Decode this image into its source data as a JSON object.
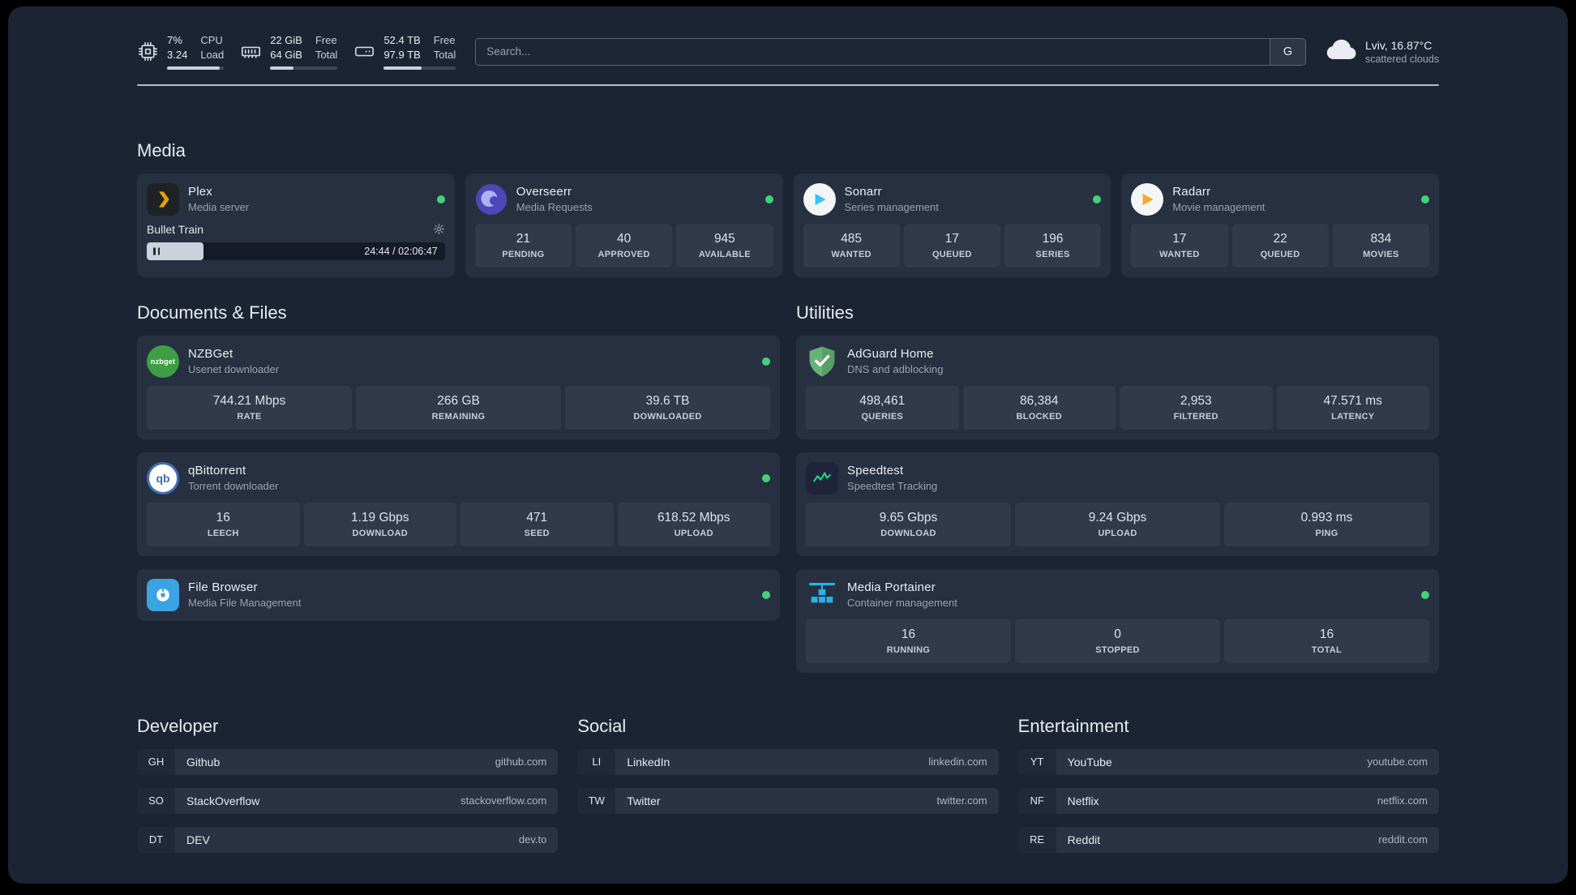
{
  "colors": {
    "background": "#1c2434",
    "card": "#273040",
    "tile": "#303a4b",
    "status_online": "#43d17a",
    "bar_fill": "#ccd3de",
    "plex_accent": "#e5a00d",
    "sonarr_accent": "#35c5f4",
    "radarr_accent": "#f7a823",
    "adguard_accent": "#67b279",
    "speedtest_accent": "#17d97a",
    "portainer_accent": "#29b1e8"
  },
  "icons": {
    "nzbget_label": "nzbget",
    "qbittorrent_label": "qb"
  },
  "topbar": {
    "cpu": {
      "value": "7%",
      "load": "3.24",
      "label_top": "CPU",
      "label_bottom": "Load",
      "bar_pct": 92
    },
    "memory": {
      "free": "22 GiB",
      "total": "64 GiB",
      "label_top": "Free",
      "label_bottom": "Total",
      "bar_pct": 34
    },
    "disk": {
      "free": "52.4 TB",
      "total": "97.9 TB",
      "label_top": "Free",
      "label_bottom": "Total",
      "bar_pct": 53
    },
    "search": {
      "placeholder": "Search...",
      "provider_button": "G"
    },
    "weather": {
      "location": "Lviv, 16.87°C",
      "condition": "scattered clouds"
    }
  },
  "sections": {
    "media": {
      "title": "Media",
      "cards": [
        {
          "name": "Plex",
          "description": "Media server",
          "status": "online",
          "player": {
            "title": "Bullet Train",
            "time": "24:44 / 02:06:47",
            "progress_pct": 19
          }
        },
        {
          "name": "Overseerr",
          "description": "Media Requests",
          "status": "online",
          "stats": [
            {
              "value": "21",
              "label": "PENDING"
            },
            {
              "value": "40",
              "label": "APPROVED"
            },
            {
              "value": "945",
              "label": "AVAILABLE"
            }
          ]
        },
        {
          "name": "Sonarr",
          "description": "Series management",
          "status": "online",
          "stats": [
            {
              "value": "485",
              "label": "WANTED"
            },
            {
              "value": "17",
              "label": "QUEUED"
            },
            {
              "value": "196",
              "label": "SERIES"
            }
          ]
        },
        {
          "name": "Radarr",
          "description": "Movie management",
          "status": "online",
          "stats": [
            {
              "value": "17",
              "label": "WANTED"
            },
            {
              "value": "22",
              "label": "QUEUED"
            },
            {
              "value": "834",
              "label": "MOVIES"
            }
          ]
        }
      ]
    },
    "documents": {
      "title": "Documents & Files",
      "cards": [
        {
          "name": "NZBGet",
          "description": "Usenet downloader",
          "status": "online",
          "stats": [
            {
              "value": "744.21 Mbps",
              "label": "RATE"
            },
            {
              "value": "266 GB",
              "label": "REMAINING"
            },
            {
              "value": "39.6 TB",
              "label": "DOWNLOADED"
            }
          ]
        },
        {
          "name": "qBittorrent",
          "description": "Torrent downloader",
          "status": "online",
          "stats": [
            {
              "value": "16",
              "label": "LEECH"
            },
            {
              "value": "1.19 Gbps",
              "label": "DOWNLOAD"
            },
            {
              "value": "471",
              "label": "SEED"
            },
            {
              "value": "618.52 Mbps",
              "label": "UPLOAD"
            }
          ]
        },
        {
          "name": "File Browser",
          "description": "Media File Management",
          "status": "online"
        }
      ]
    },
    "utilities": {
      "title": "Utilities",
      "cards": [
        {
          "name": "AdGuard Home",
          "description": "DNS and adblocking",
          "stats": [
            {
              "value": "498,461",
              "label": "QUERIES"
            },
            {
              "value": "86,384",
              "label": "BLOCKED"
            },
            {
              "value": "2,953",
              "label": "FILTERED"
            },
            {
              "value": "47.571 ms",
              "label": "LATENCY"
            }
          ]
        },
        {
          "name": "Speedtest",
          "description": "Speedtest Tracking",
          "stats": [
            {
              "value": "9.65 Gbps",
              "label": "DOWNLOAD"
            },
            {
              "value": "9.24 Gbps",
              "label": "UPLOAD"
            },
            {
              "value": "0.993 ms",
              "label": "PING"
            }
          ]
        },
        {
          "name": "Media Portainer",
          "description": "Container management",
          "status": "online",
          "stats": [
            {
              "value": "16",
              "label": "RUNNING"
            },
            {
              "value": "0",
              "label": "STOPPED"
            },
            {
              "value": "16",
              "label": "TOTAL"
            }
          ]
        }
      ]
    }
  },
  "bookmarks": [
    {
      "title": "Developer",
      "items": [
        {
          "abbr": "GH",
          "name": "Github",
          "url": "github.com"
        },
        {
          "abbr": "SO",
          "name": "StackOverflow",
          "url": "stackoverflow.com"
        },
        {
          "abbr": "DT",
          "name": "DEV",
          "url": "dev.to"
        }
      ]
    },
    {
      "title": "Social",
      "items": [
        {
          "abbr": "LI",
          "name": "LinkedIn",
          "url": "linkedin.com"
        },
        {
          "abbr": "TW",
          "name": "Twitter",
          "url": "twitter.com"
        }
      ]
    },
    {
      "title": "Entertainment",
      "items": [
        {
          "abbr": "YT",
          "name": "YouTube",
          "url": "youtube.com"
        },
        {
          "abbr": "NF",
          "name": "Netflix",
          "url": "netflix.com"
        },
        {
          "abbr": "RE",
          "name": "Reddit",
          "url": "reddit.com"
        }
      ]
    }
  ]
}
